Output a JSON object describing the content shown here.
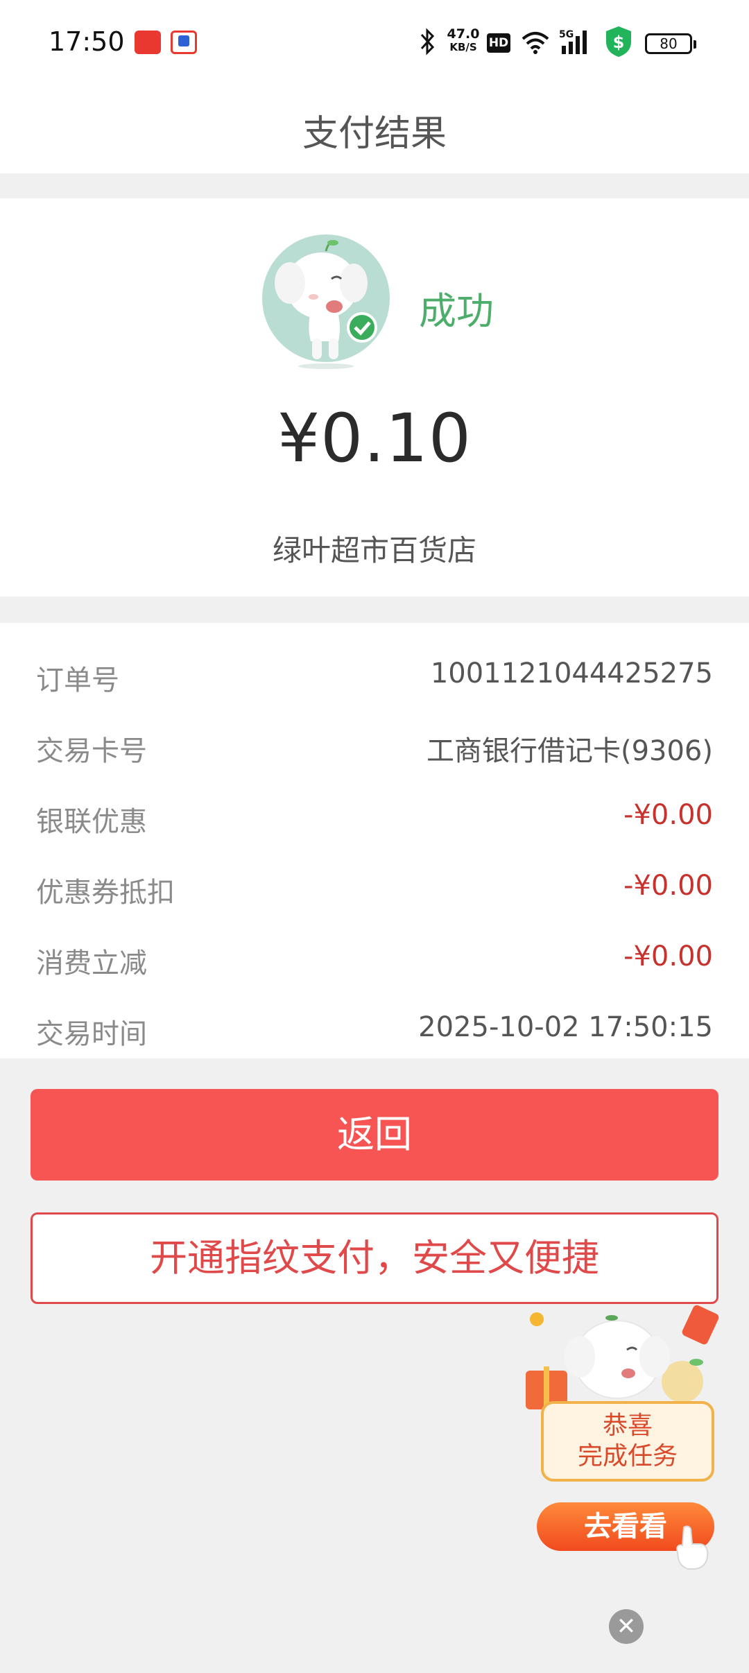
{
  "status_bar": {
    "time": "17:50",
    "net_speed_value": "47.0",
    "net_speed_unit": "KB/S",
    "hd_label": "HD",
    "network_label": "5G",
    "battery": "80"
  },
  "header": {
    "title": "支付结果"
  },
  "result": {
    "status": "成功",
    "amount": "¥0.10",
    "merchant": "绿叶超市百货店",
    "status_color": "#4cae6a"
  },
  "details": [
    {
      "label": "订单号",
      "value": "1001121044425275"
    },
    {
      "label": "交易卡号",
      "value": "工商银行借记卡(9306)"
    },
    {
      "label": "银联优惠",
      "value": "-¥0.00"
    },
    {
      "label": "优惠券抵扣",
      "value": "-¥0.00"
    },
    {
      "label": "消费立减",
      "value": "-¥0.00"
    },
    {
      "label": "交易时间",
      "value": "2025-10-02 17:50:15"
    }
  ],
  "buttons": {
    "back": "返回",
    "fingerprint": "开通指纹支付，安全又便捷"
  },
  "promo": {
    "line1": "恭喜",
    "line2": "完成任务",
    "action": "去看看",
    "close_icon": "✕"
  },
  "colors": {
    "primary_red": "#f65554",
    "discount_red": "#c8322d",
    "success_green": "#4cae6a"
  }
}
